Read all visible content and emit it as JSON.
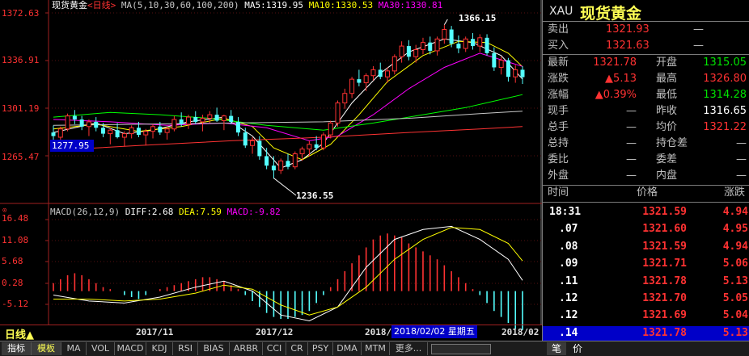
{
  "colors": {
    "up": "#ff3232",
    "down": "#54ffff",
    "ma5": "#ffffff",
    "ma10": "#ffff00",
    "ma30": "#ff00ff",
    "ma60": "#00ff00",
    "ma100": "#c8c8c8",
    "ma200": "#ff3333",
    "label": "#ff3232",
    "axis": "#a02020",
    "yellow": "#ffff54",
    "green": "#00e400",
    "blue": "#0000c8"
  },
  "chart": {
    "price_header": {
      "name": "现货黄金",
      "period": "日线",
      "ma_params": "MA(5,10,30,60,100,200)",
      "ma5": "MA5:1319.95",
      "ma10": "MA10:1330.53",
      "ma30": "MA30:1330.81"
    },
    "price_axis": [
      "1372.63",
      "1336.91",
      "1301.19",
      "1265.47"
    ],
    "current_price_tag": "1277.95",
    "high_label": "1366.15",
    "low_label": "1236.55",
    "macd_header": {
      "params": "MACD(26,12,9)",
      "diff": "DIFF:2.68",
      "dea": "DEA:7.59",
      "macd": "MACD:-9.82"
    },
    "macd_axis": [
      "16.48",
      "11.08",
      "5.68",
      "0.28",
      "-5.12"
    ],
    "x_labels": [
      "2017/11",
      "2017/12",
      "2018/",
      "2018/02"
    ],
    "cursor_date": "2018/02/02  星期五",
    "period_label": "日线▲"
  },
  "chart_data": {
    "type": "candlestick",
    "ylim": [
      1226,
      1376
    ],
    "candles": [
      [
        1275,
        1281,
        1268,
        1272
      ],
      [
        1271,
        1280,
        1265,
        1278
      ],
      [
        1278,
        1291,
        1276,
        1289
      ],
      [
        1289,
        1294,
        1282,
        1286
      ],
      [
        1286,
        1289,
        1277,
        1280
      ],
      [
        1280,
        1286,
        1272,
        1284
      ],
      [
        1284,
        1288,
        1276,
        1279
      ],
      [
        1279,
        1283,
        1271,
        1274
      ],
      [
        1274,
        1279,
        1265,
        1277
      ],
      [
        1277,
        1283,
        1270,
        1271
      ],
      [
        1271,
        1276,
        1263,
        1274
      ],
      [
        1274,
        1281,
        1270,
        1279
      ],
      [
        1279,
        1284,
        1271,
        1273
      ],
      [
        1273,
        1278,
        1264,
        1276
      ],
      [
        1276,
        1282,
        1270,
        1280
      ],
      [
        1280,
        1284,
        1273,
        1275
      ],
      [
        1275,
        1280,
        1269,
        1278
      ],
      [
        1278,
        1289,
        1276,
        1286
      ],
      [
        1286,
        1292,
        1280,
        1282
      ],
      [
        1282,
        1290,
        1278,
        1288
      ],
      [
        1288,
        1293,
        1282,
        1284
      ],
      [
        1284,
        1290,
        1276,
        1287
      ],
      [
        1287,
        1293,
        1283,
        1290
      ],
      [
        1290,
        1296,
        1284,
        1285
      ],
      [
        1285,
        1290,
        1277,
        1289
      ],
      [
        1289,
        1294,
        1282,
        1284
      ],
      [
        1284,
        1288,
        1272,
        1275
      ],
      [
        1275,
        1279,
        1262,
        1264
      ],
      [
        1264,
        1271,
        1257,
        1268
      ],
      [
        1268,
        1272,
        1252,
        1255
      ],
      [
        1255,
        1262,
        1244,
        1247
      ],
      [
        1247,
        1255,
        1236,
        1243
      ],
      [
        1243,
        1253,
        1240,
        1251
      ],
      [
        1251,
        1257,
        1244,
        1246
      ],
      [
        1246,
        1259,
        1244,
        1257
      ],
      [
        1257,
        1263,
        1251,
        1261
      ],
      [
        1261,
        1268,
        1255,
        1265
      ],
      [
        1265,
        1272,
        1260,
        1262
      ],
      [
        1262,
        1275,
        1260,
        1273
      ],
      [
        1273,
        1285,
        1270,
        1283
      ],
      [
        1283,
        1302,
        1280,
        1300
      ],
      [
        1300,
        1312,
        1295,
        1308
      ],
      [
        1308,
        1322,
        1304,
        1320
      ],
      [
        1320,
        1328,
        1314,
        1317
      ],
      [
        1317,
        1325,
        1310,
        1323
      ],
      [
        1323,
        1331,
        1319,
        1328
      ],
      [
        1328,
        1334,
        1320,
        1322
      ],
      [
        1322,
        1330,
        1317,
        1327
      ],
      [
        1327,
        1341,
        1324,
        1339
      ],
      [
        1339,
        1352,
        1334,
        1348
      ],
      [
        1348,
        1353,
        1336,
        1339
      ],
      [
        1339,
        1349,
        1334,
        1345
      ],
      [
        1345,
        1355,
        1341,
        1351
      ],
      [
        1351,
        1356,
        1341,
        1344
      ],
      [
        1344,
        1356,
        1340,
        1354
      ],
      [
        1354,
        1366,
        1350,
        1362
      ],
      [
        1362,
        1365,
        1347,
        1350
      ],
      [
        1350,
        1357,
        1342,
        1346
      ],
      [
        1346,
        1356,
        1343,
        1354
      ],
      [
        1354,
        1359,
        1345,
        1348
      ],
      [
        1348,
        1358,
        1343,
        1355
      ],
      [
        1355,
        1358,
        1340,
        1342
      ],
      [
        1342,
        1347,
        1327,
        1330
      ],
      [
        1330,
        1339,
        1324,
        1336
      ],
      [
        1336,
        1338,
        1318,
        1322
      ],
      [
        1322,
        1332,
        1317,
        1328
      ],
      [
        1328,
        1331,
        1316,
        1321.78
      ]
    ],
    "ma_series": [
      {
        "name": "MA5",
        "key": "ma5",
        "points": [
          [
            0,
            1275
          ],
          [
            6,
            1283
          ],
          [
            10,
            1274
          ],
          [
            14,
            1277
          ],
          [
            19,
            1284
          ],
          [
            24,
            1288
          ],
          [
            28,
            1272
          ],
          [
            32,
            1245
          ],
          [
            35,
            1252
          ],
          [
            38,
            1266
          ],
          [
            42,
            1300
          ],
          [
            46,
            1325
          ],
          [
            50,
            1343
          ],
          [
            55,
            1354
          ],
          [
            59,
            1351
          ],
          [
            63,
            1340
          ],
          [
            66,
            1320
          ]
        ]
      },
      {
        "name": "MA10",
        "key": "ma10",
        "points": [
          [
            0,
            1278
          ],
          [
            6,
            1282
          ],
          [
            12,
            1276
          ],
          [
            18,
            1280
          ],
          [
            24,
            1287
          ],
          [
            28,
            1280
          ],
          [
            31,
            1262
          ],
          [
            35,
            1252
          ],
          [
            39,
            1265
          ],
          [
            43,
            1290
          ],
          [
            47,
            1318
          ],
          [
            52,
            1340
          ],
          [
            57,
            1352
          ],
          [
            61,
            1351
          ],
          [
            64,
            1342
          ],
          [
            66,
            1330.5
          ]
        ]
      },
      {
        "name": "MA30",
        "key": "ma30",
        "points": [
          [
            0,
            1286
          ],
          [
            8,
            1284
          ],
          [
            16,
            1281
          ],
          [
            24,
            1283
          ],
          [
            30,
            1279
          ],
          [
            36,
            1268
          ],
          [
            40,
            1272
          ],
          [
            45,
            1290
          ],
          [
            50,
            1312
          ],
          [
            55,
            1330
          ],
          [
            60,
            1342
          ],
          [
            66,
            1330.8
          ]
        ]
      },
      {
        "name": "MA60",
        "key": "ma60",
        "points": [
          [
            0,
            1288
          ],
          [
            8,
            1292
          ],
          [
            15,
            1290
          ],
          [
            22,
            1287
          ],
          [
            30,
            1281
          ],
          [
            38,
            1277
          ],
          [
            45,
            1283
          ],
          [
            52,
            1290
          ],
          [
            58,
            1296
          ],
          [
            66,
            1307
          ]
        ]
      },
      {
        "name": "MA100",
        "key": "ma100",
        "points": [
          [
            0,
            1281
          ],
          [
            12,
            1282
          ],
          [
            25,
            1283
          ],
          [
            38,
            1284
          ],
          [
            50,
            1287
          ],
          [
            60,
            1291
          ],
          [
            66,
            1293
          ]
        ]
      },
      {
        "name": "MA200",
        "key": "ma200",
        "points": [
          [
            0,
            1260
          ],
          [
            12,
            1264
          ],
          [
            25,
            1268
          ],
          [
            38,
            1271
          ],
          [
            50,
            1275
          ],
          [
            60,
            1278
          ],
          [
            66,
            1280
          ]
        ]
      }
    ],
    "macd": {
      "ylim": [
        -8,
        18
      ],
      "hist": [
        2,
        3,
        4,
        4.5,
        4,
        3,
        2,
        1,
        0.5,
        0,
        -1,
        -1.5,
        -2,
        -1,
        0,
        0.5,
        1,
        1.5,
        2,
        2.5,
        3,
        3.5,
        3.5,
        3,
        2.5,
        1.5,
        0.5,
        -1,
        -2.5,
        -4,
        -5.5,
        -6.5,
        -7,
        -7,
        -6.5,
        -6,
        -5,
        -3,
        -1,
        1,
        3,
        5,
        7,
        9,
        11,
        13,
        14,
        14.5,
        14,
        13.5,
        12,
        11,
        10,
        9,
        8,
        6.5,
        5,
        3.5,
        2,
        0.5,
        -1,
        -3,
        -5,
        -6.5,
        -8,
        -9.5,
        -9.8
      ],
      "diff": [
        [
          0,
          -1
        ],
        [
          5,
          -2.5
        ],
        [
          10,
          -3
        ],
        [
          15,
          -1.5
        ],
        [
          20,
          1
        ],
        [
          24,
          2.5
        ],
        [
          28,
          0
        ],
        [
          32,
          -6
        ],
        [
          36,
          -7.5
        ],
        [
          40,
          -4
        ],
        [
          44,
          6
        ],
        [
          48,
          13
        ],
        [
          52,
          15.5
        ],
        [
          56,
          16.3
        ],
        [
          60,
          13
        ],
        [
          64,
          8
        ],
        [
          66,
          2.7
        ]
      ],
      "dea": [
        [
          0,
          -2
        ],
        [
          5,
          -2
        ],
        [
          10,
          -2.5
        ],
        [
          15,
          -2
        ],
        [
          20,
          -0.5
        ],
        [
          24,
          1.5
        ],
        [
          28,
          0.5
        ],
        [
          32,
          -3.5
        ],
        [
          36,
          -6
        ],
        [
          40,
          -4
        ],
        [
          44,
          1
        ],
        [
          48,
          8
        ],
        [
          52,
          13
        ],
        [
          56,
          16
        ],
        [
          60,
          15.5
        ],
        [
          64,
          12
        ],
        [
          66,
          7.6
        ]
      ]
    }
  },
  "quote": {
    "symbol_code": "XAU",
    "symbol_name": "现货黄金",
    "sell_label": "卖出",
    "sell_value": "1321.93",
    "sell_vol": "—",
    "buy_label": "买入",
    "buy_value": "1321.63",
    "buy_vol": "—",
    "rows": [
      {
        "l1": "最新",
        "v1": "1321.78",
        "c1": "#ff3232",
        "l2": "开盘",
        "v2": "1315.05",
        "c2": "#00e400"
      },
      {
        "l1": "涨跌",
        "v1": "▲5.13",
        "c1": "#ff3232",
        "l2": "最高",
        "v2": "1326.80",
        "c2": "#ff3232"
      },
      {
        "l1": "涨幅",
        "v1": "▲0.39%",
        "c1": "#ff3232",
        "l2": "最低",
        "v2": "1314.28",
        "c2": "#00e400"
      },
      {
        "l1": "现手",
        "v1": "—",
        "c1": "#c0c0c0",
        "l2": "昨收",
        "v2": "1316.65",
        "c2": "#ffffff"
      },
      {
        "l1": "总手",
        "v1": "—",
        "c1": "#c0c0c0",
        "l2": "均价",
        "v2": "1321.22",
        "c2": "#ff3232"
      },
      {
        "l1": "总持",
        "v1": "—",
        "c1": "#c0c0c0",
        "l2": "持仓差",
        "v2": "—",
        "c2": "#c0c0c0"
      },
      {
        "l1": "委比",
        "v1": "—",
        "c1": "#c0c0c0",
        "l2": "委差",
        "v2": "—",
        "c2": "#c0c0c0"
      },
      {
        "l1": "外盘",
        "v1": "—",
        "c1": "#c0c0c0",
        "l2": "内盘",
        "v2": "—",
        "c2": "#c0c0c0"
      }
    ]
  },
  "ticks": {
    "headers": {
      "time": "时间",
      "price": "价格",
      "change": "涨跌"
    },
    "rows": [
      {
        "time": "18:31",
        "price": "1321.59",
        "change": "4.94"
      },
      {
        "time": ".07",
        "price": "1321.60",
        "change": "4.95"
      },
      {
        "time": ".08",
        "price": "1321.59",
        "change": "4.94"
      },
      {
        "time": ".09",
        "price": "1321.71",
        "change": "5.06"
      },
      {
        "time": ".11",
        "price": "1321.78",
        "change": "5.13"
      },
      {
        "time": ".12",
        "price": "1321.70",
        "change": "5.05"
      },
      {
        "time": ".12",
        "price": "1321.69",
        "change": "5.04"
      },
      {
        "time": ".14",
        "price": "1321.78",
        "change": "5.13"
      }
    ]
  },
  "tabs": [
    "指标",
    "模板",
    "MA",
    "VOL",
    "MACD",
    "KDJ",
    "RSI",
    "BIAS",
    "ARBR",
    "CCI",
    "CR",
    "PSY",
    "DMA",
    "MTM",
    "更多..."
  ],
  "right_tabs": [
    "笔",
    "价"
  ]
}
